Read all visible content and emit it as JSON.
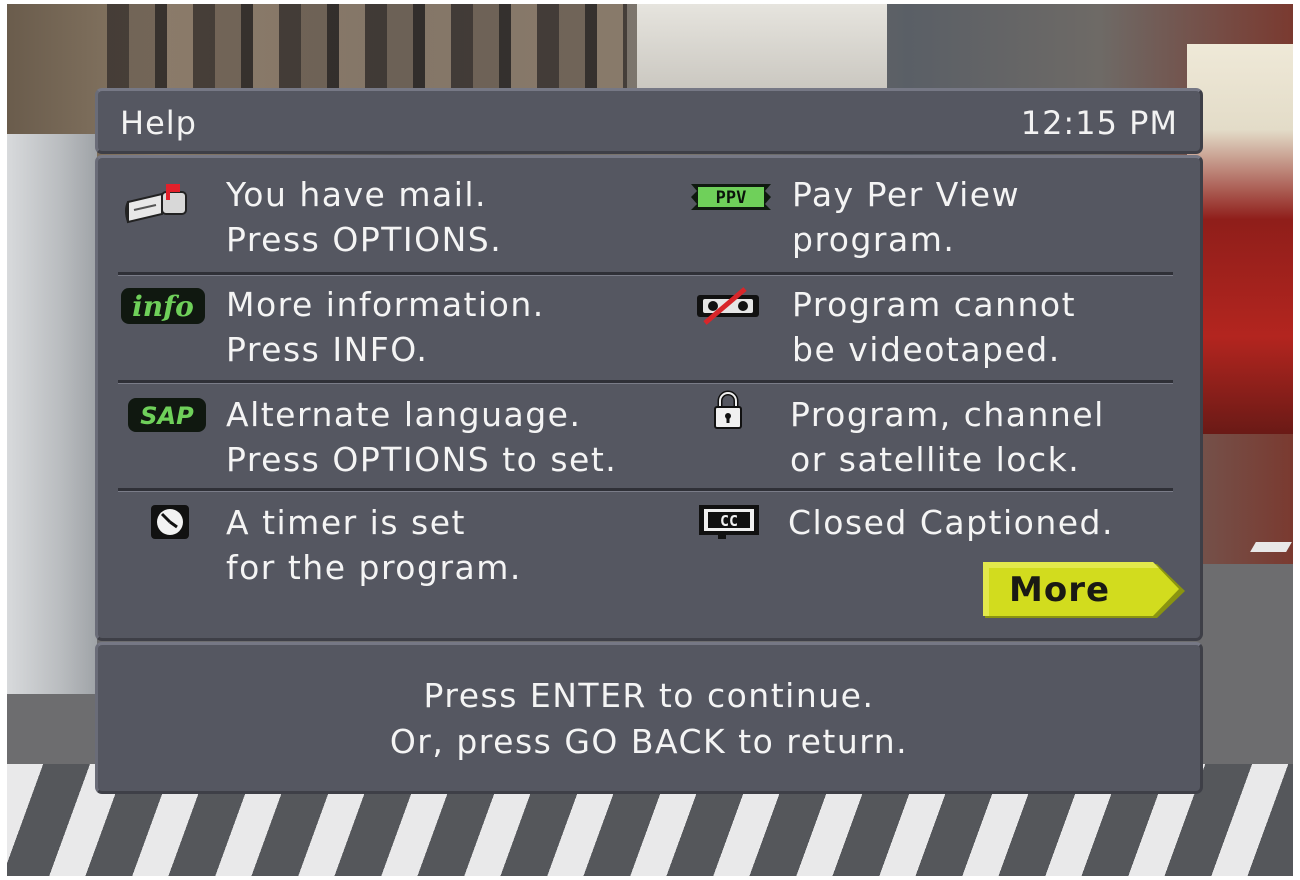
{
  "header": {
    "title": "Help",
    "clock": "12:15 PM"
  },
  "legend": [
    {
      "icon": "mailbox-icon",
      "line1": "You have mail.",
      "line2": "Press OPTIONS."
    },
    {
      "icon": "ppv-ticket-icon",
      "icon_text": "PPV",
      "line1": "Pay Per View",
      "line2": "program."
    },
    {
      "icon": "info-icon",
      "icon_text": "info",
      "line1": "More  information.",
      "line2": "Press INFO."
    },
    {
      "icon": "no-videotape-icon",
      "line1": "Program cannot",
      "line2": "be videotaped."
    },
    {
      "icon": "sap-icon",
      "icon_text": "SAP",
      "line1": "Alternate language.",
      "line2": "Press OPTIONS to set."
    },
    {
      "icon": "lock-icon",
      "line1": "Program, channel",
      "line2": "or satellite lock."
    },
    {
      "icon": "timer-clock-icon",
      "line1": "A  timer is set",
      "line2": "for the program."
    },
    {
      "icon": "closed-caption-icon",
      "icon_text": "CC",
      "line1": "Closed Captioned.",
      "line2": ""
    }
  ],
  "more_button": {
    "label": "More"
  },
  "footer": {
    "line1": "Press ENTER to continue.",
    "line2": "Or, press GO BACK to return."
  },
  "colors": {
    "panel": "#555761",
    "text": "#f4f4f4",
    "more_button": "#d2dc1e",
    "icon_green": "#6fd05a"
  }
}
